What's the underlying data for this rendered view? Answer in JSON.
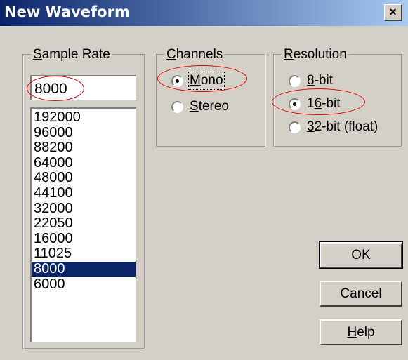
{
  "window": {
    "title": "New Waveform",
    "close_label": "×"
  },
  "sample_rate": {
    "legend": "Sample Rate",
    "value": "8000",
    "options": [
      "192000",
      "96000",
      "88200",
      "64000",
      "48000",
      "44100",
      "32000",
      "22050",
      "16000",
      "11025",
      "8000",
      "6000"
    ],
    "selected": "8000"
  },
  "channels": {
    "legend": "Channels",
    "options": [
      {
        "label": "Mono",
        "checked": true
      },
      {
        "label": "Stereo",
        "checked": false
      }
    ]
  },
  "resolution": {
    "legend": "Resolution",
    "options": [
      {
        "label": "8-bit",
        "checked": false
      },
      {
        "label": "16-bit",
        "checked": true
      },
      {
        "label": "32-bit (float)",
        "checked": false
      }
    ]
  },
  "buttons": {
    "ok": "OK",
    "cancel": "Cancel",
    "help": "Help"
  },
  "colors": {
    "highlight": "#0a246a",
    "annotation": "#e00000"
  }
}
